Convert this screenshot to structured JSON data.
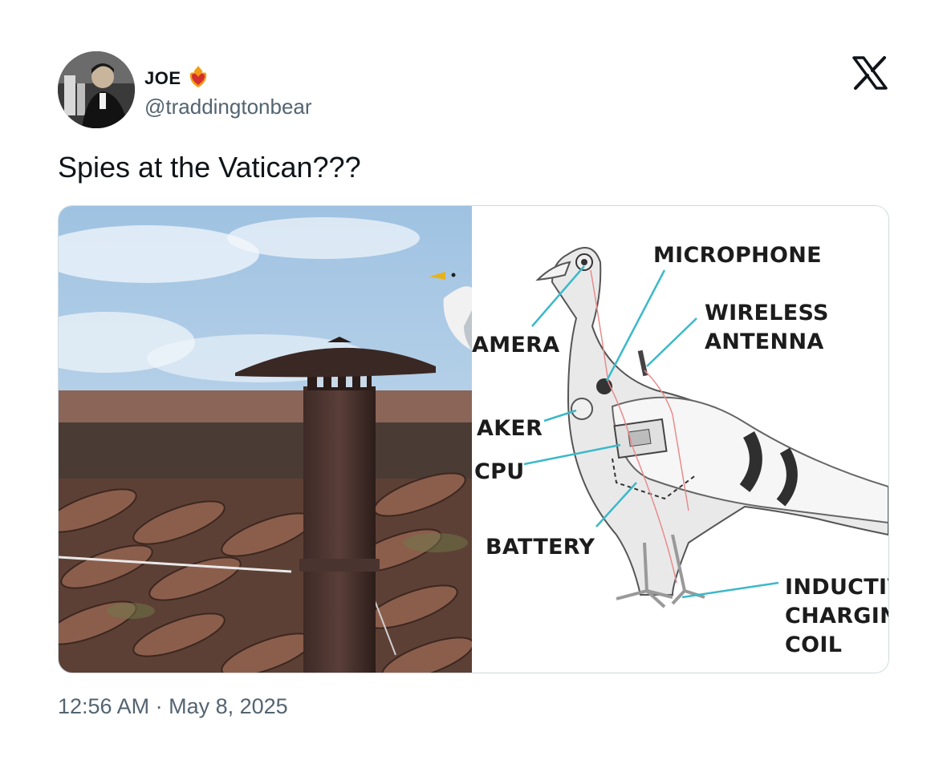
{
  "author": {
    "display_name": "JOE",
    "badge_icon": "flaming-heart-icon",
    "handle": "@traddingtonbear"
  },
  "brand": {
    "icon": "x-logo-icon"
  },
  "tweet": {
    "text": "Spies at the Vatican???",
    "timestamp": "12:56 AM · May 8, 2025"
  },
  "media": {
    "labels": {
      "microphone": "MICROPHONE",
      "camera": "AMERA",
      "wireless_antenna_line1": "WIRELESS",
      "wireless_antenna_line2": "ANTENNA",
      "speaker": "AKER",
      "cpu": "CPU",
      "battery": "BATTERY",
      "charging_line1": "INDUCTIV",
      "charging_line2": "CHARGIN",
      "charging_line3": "COIL"
    }
  },
  "colors": {
    "text_primary": "#0f1419",
    "text_secondary": "#536471",
    "callout_line": "#3bb9c9",
    "sky": "#b9d3ea"
  }
}
